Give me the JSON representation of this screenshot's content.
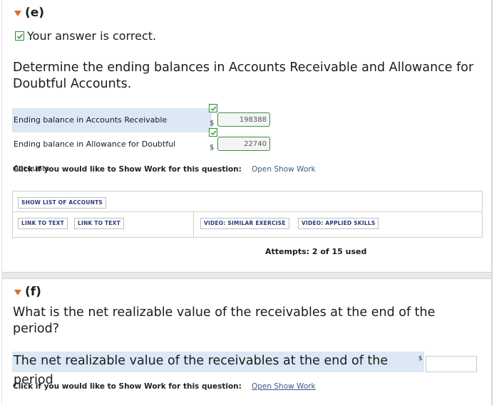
{
  "part_e": {
    "label": "(e)",
    "status": "Your answer is correct.",
    "question": "Determine the ending balances in Accounts Receivable and Allowance for Doubtful Accounts.",
    "rows": [
      {
        "label": "Ending balance in Accounts Receivable",
        "currency": "$",
        "value": "198388"
      },
      {
        "label": "Ending balance in Allowance for Doubtful Accounts",
        "currency": "$",
        "value": "22740"
      }
    ],
    "show_work_prompt": "Click if you would like to Show Work for this question:",
    "show_work_link": "Open Show Work",
    "resources": {
      "show_accounts": "SHOW LIST OF ACCOUNTS",
      "link_text_1": "LINK TO TEXT",
      "link_text_2": "LINK TO TEXT",
      "video_similar": "VIDEO: SIMILAR EXERCISE",
      "video_applied": "VIDEO: APPLIED SKILLS"
    },
    "attempts": "Attempts: 2 of 15 used"
  },
  "part_f": {
    "label": "(f)",
    "question": "What is the net realizable value of the receivables at the end of the period?",
    "row_label": "The net realizable value of the receivables at the end of the period",
    "currency": "$",
    "value": "",
    "show_work_prompt": "Click if you would like to Show Work for this question:",
    "show_work_link": "Open Show Work"
  },
  "colors": {
    "accent_orange": "#e8691b",
    "correct_green": "#2e8b2e",
    "row_highlight": "#dde8f6",
    "link_blue": "#3a5a86"
  },
  "icons": [
    "collapse-triangle-icon",
    "checkmark-icon"
  ]
}
